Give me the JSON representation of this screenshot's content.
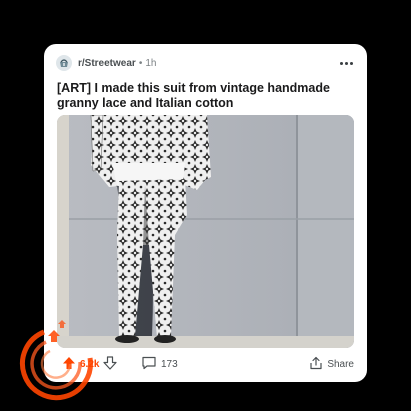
{
  "post": {
    "subreddit": "r/Streetwear",
    "separator": "•",
    "time_ago": "1h",
    "title": "[ART] I made this suit from vintage handmade granny lace and Italian cotton"
  },
  "actions": {
    "upvote_count": "6.2k",
    "comment_count": "173",
    "share_label": "Share"
  },
  "icons": {
    "subreddit": "subreddit-avatar-icon",
    "more": "more-options-icon",
    "upvote": "upvote-arrow-icon",
    "downvote": "downvote-arrow-icon",
    "comment": "comment-bubble-icon",
    "share": "share-icon"
  },
  "colors": {
    "accent": "#ff4500",
    "card_background": "#ffffff",
    "page_background": "#000000"
  }
}
